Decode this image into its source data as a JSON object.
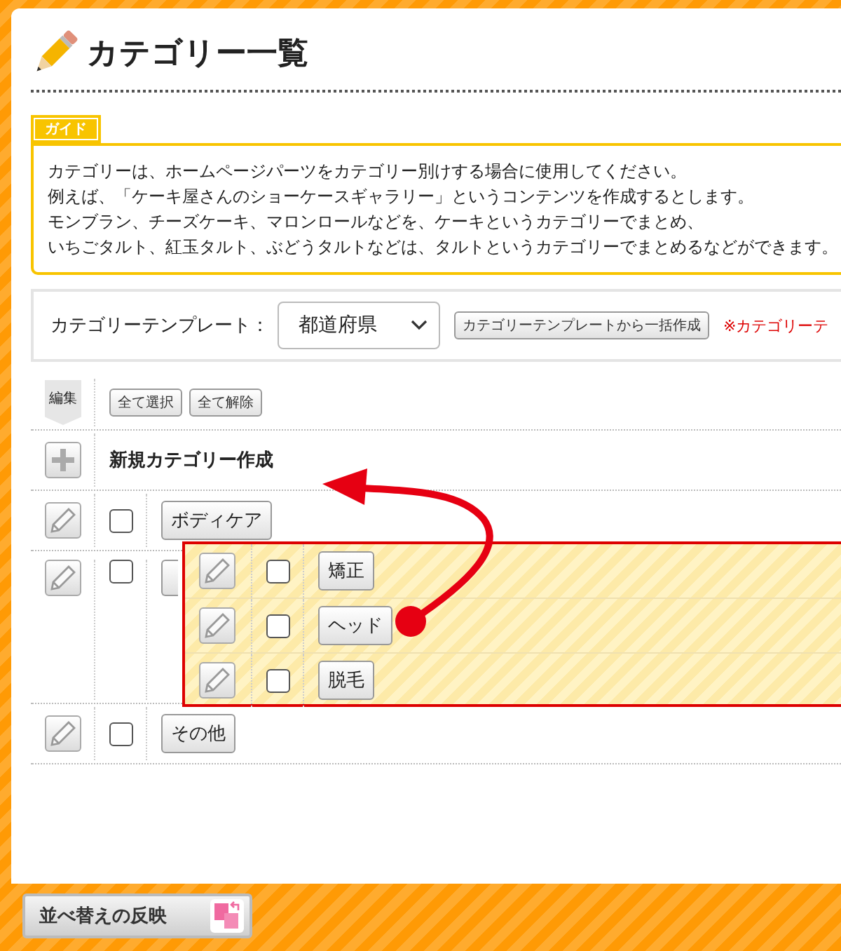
{
  "page_title": "カテゴリー一覧",
  "guide": {
    "tag": "ガイド",
    "lines": [
      "カテゴリーは、ホームページパーツをカテゴリー別けする場合に使用してください。",
      "例えば、「ケーキ屋さんのショーケースギャラリー」というコンテンツを作成するとします。",
      "モンブラン、チーズケーキ、マロンロールなどを、ケーキというカテゴリーでまとめ、",
      "いちごタルト、紅玉タルト、ぶどうタルトなどは、タルトというカテゴリーでまとめるなどができます。"
    ]
  },
  "template_bar": {
    "label": "カテゴリーテンプレート：",
    "select_value": "都道府県",
    "create_button": "カテゴリーテンプレートから一括作成",
    "note": "※カテゴリーテ"
  },
  "list_header": {
    "edit_label": "編集",
    "buttons": [
      "全て選択",
      "全て解除"
    ]
  },
  "new_category": {
    "label": "新規カテゴリー作成"
  },
  "categories": [
    {
      "kind": "row",
      "name": "ボディケア",
      "checked": false
    },
    {
      "kind": "drop_target",
      "checked": false
    },
    {
      "kind": "row",
      "name": "その他",
      "checked": false
    }
  ],
  "dragged_group": [
    {
      "name": "矯正",
      "checked": false
    },
    {
      "name": "ヘッド",
      "checked": false
    },
    {
      "name": "脱毛",
      "checked": false
    }
  ],
  "footer": {
    "apply_button": "並べ替えの反映"
  }
}
